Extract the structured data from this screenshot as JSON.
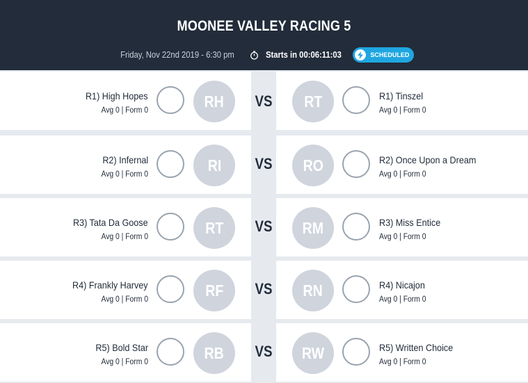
{
  "header": {
    "title": "MOONEE VALLEY RACING 5",
    "date": "Friday, Nov 22nd 2019 - 6:30 pm",
    "starts": "Starts in 00:06:11:03",
    "status": "SCHEDULED"
  },
  "vs_label": "VS",
  "matchups": [
    {
      "left": {
        "name": "R1) High Hopes",
        "stats": "Avg 0 | Form 0",
        "initials": "RH"
      },
      "right": {
        "name": "R1) Tinszel",
        "stats": "Avg 0 | Form 0",
        "initials": "RT"
      }
    },
    {
      "left": {
        "name": "R2) Infernal",
        "stats": "Avg 0 | Form 0",
        "initials": "RI"
      },
      "right": {
        "name": "R2) Once Upon a Dream",
        "stats": "Avg 0 | Form 0",
        "initials": "RO"
      }
    },
    {
      "left": {
        "name": "R3) Tata Da Goose",
        "stats": "Avg 0 | Form 0",
        "initials": "RT"
      },
      "right": {
        "name": "R3) Miss Entice",
        "stats": "Avg 0 | Form 0",
        "initials": "RM"
      }
    },
    {
      "left": {
        "name": "R4) Frankly Harvey",
        "stats": "Avg 0 | Form 0",
        "initials": "RF"
      },
      "right": {
        "name": "R4) Nicajon",
        "stats": "Avg 0 | Form 0",
        "initials": "RN"
      }
    },
    {
      "left": {
        "name": "R5) Bold Star",
        "stats": "Avg 0 | Form 0",
        "initials": "RB"
      },
      "right": {
        "name": "R5) Written Choice",
        "stats": "Avg 0 | Form 0",
        "initials": "RW"
      }
    }
  ],
  "colors": {
    "header_bg": "#222c3a",
    "accent": "#1fa6e0",
    "avatar_bg": "#cfd4dd",
    "page_bg": "#e6eaef"
  }
}
